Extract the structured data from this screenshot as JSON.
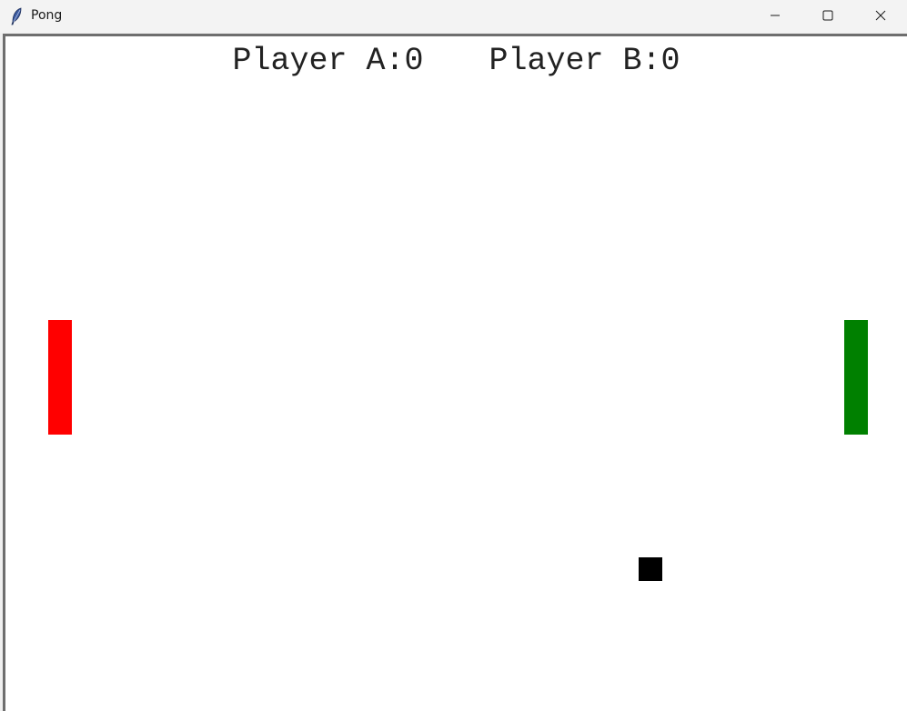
{
  "window": {
    "title": "Pong",
    "icons": {
      "app": "feather-icon",
      "minimize": "minimize-icon",
      "maximize": "maximize-icon",
      "close": "close-icon"
    }
  },
  "game": {
    "player_a_label": "Player A:",
    "player_a_score": "0",
    "player_b_label": "Player B:",
    "player_b_score": "0",
    "colors": {
      "paddle_a": "#ff0000",
      "paddle_b": "#008000",
      "ball": "#000000",
      "background": "#ffffff",
      "score_text": "#222222"
    }
  }
}
